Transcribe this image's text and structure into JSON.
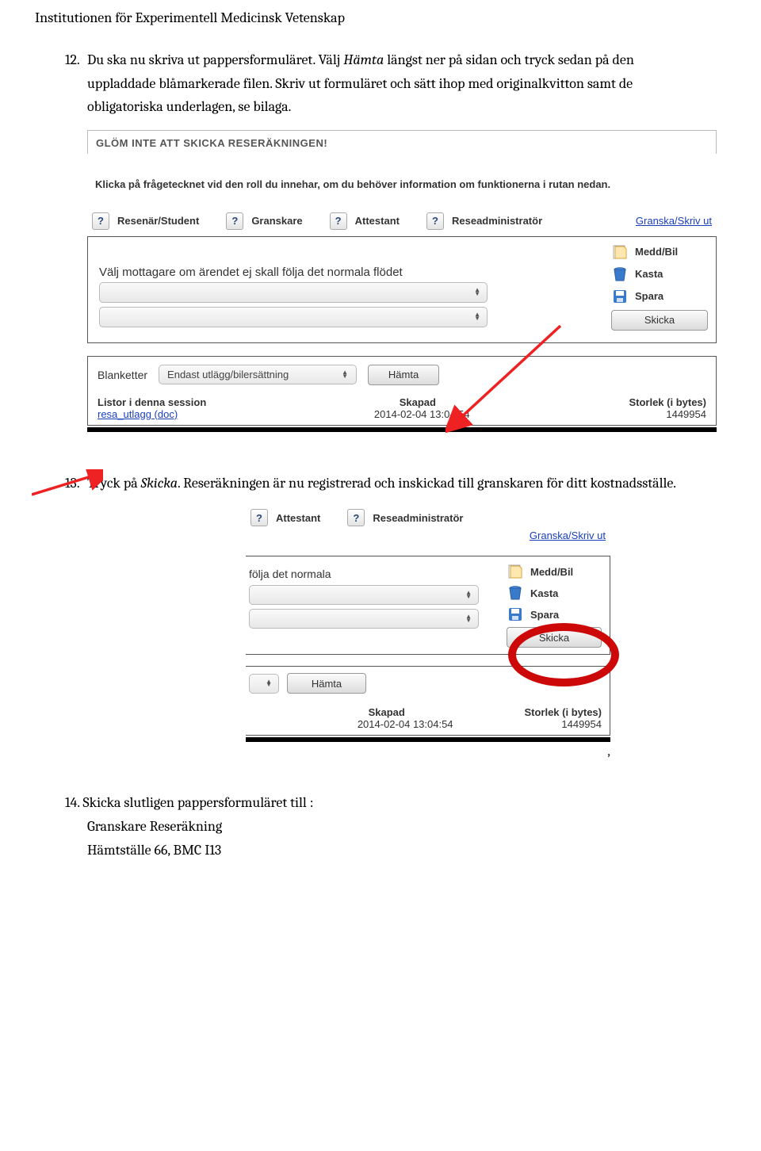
{
  "header": "Institutionen för Experimentell Medicinsk Vetenskap",
  "step12": {
    "num": "12.",
    "text_a": "Du ska nu skriva ut pappersformuläret. Välj ",
    "hamta": "Hämta",
    "text_b": " längst ner på sidan och tryck sedan på den uppladdade blåmarkerade filen. Skriv ut formuläret och sätt ihop med originalkvitton samt de obligatoriska underlagen, se bilaga."
  },
  "ss1": {
    "top_banner": "GLÖM INTE ATT SKICKA RESERÄKNINGEN!",
    "info": "Klicka på frågetecknet vid den roll du innehar, om du behöver information om funktionerna i rutan nedan.",
    "q": "?",
    "roles": [
      "Resenär/Student",
      "Granskare",
      "Attestant",
      "Reseadministratör"
    ],
    "granska_link": "Granska/Skriv ut",
    "mottagare_text": "Välj mottagare om ärendet ej skall följa det normala flödet",
    "actions": {
      "medd": "Medd/Bil",
      "kasta": "Kasta",
      "spara": "Spara",
      "skicka": "Skicka"
    },
    "blanketter_label": "Blanketter",
    "blanketter_value": "Endast utlägg/bilersättning",
    "hamta_btn": "Hämta",
    "session_hdr": {
      "listor": "Listor i denna session",
      "skapad": "Skapad",
      "storlek": "Storlek (i bytes)"
    },
    "session_data": {
      "file": "resa_utlagg (doc)",
      "date": "2014-02-04 13:04:54",
      "bytes": "1449954"
    }
  },
  "step13": {
    "num": "13.",
    "text_a": "Tryck på ",
    "skicka": "Skicka",
    "text_b": ". Reseräkningen är nu registrerad och inskickad till granskaren för ditt kostnadsställe."
  },
  "ss2": {
    "roles": [
      "Attestant",
      "Reseadministratör"
    ],
    "granska_link": "Granska/Skriv ut",
    "mottagare_text": "följa det normala",
    "actions": {
      "medd": "Medd/Bil",
      "kasta": "Kasta",
      "spara": "Spara",
      "skicka": "Skicka"
    },
    "hamta_btn": "Hämta",
    "session_hdr": {
      "skapad": "Skapad",
      "storlek": "Storlek (i bytes)"
    },
    "session_data": {
      "date": "2014-02-04 13:04:54",
      "bytes": "1449954"
    }
  },
  "step14": {
    "num": "14.",
    "text": "Skicka slutligen pappersformuläret till :",
    "l1": "Granskare Reseräkning",
    "l2": "Hämtställe 66, BMC I13"
  }
}
